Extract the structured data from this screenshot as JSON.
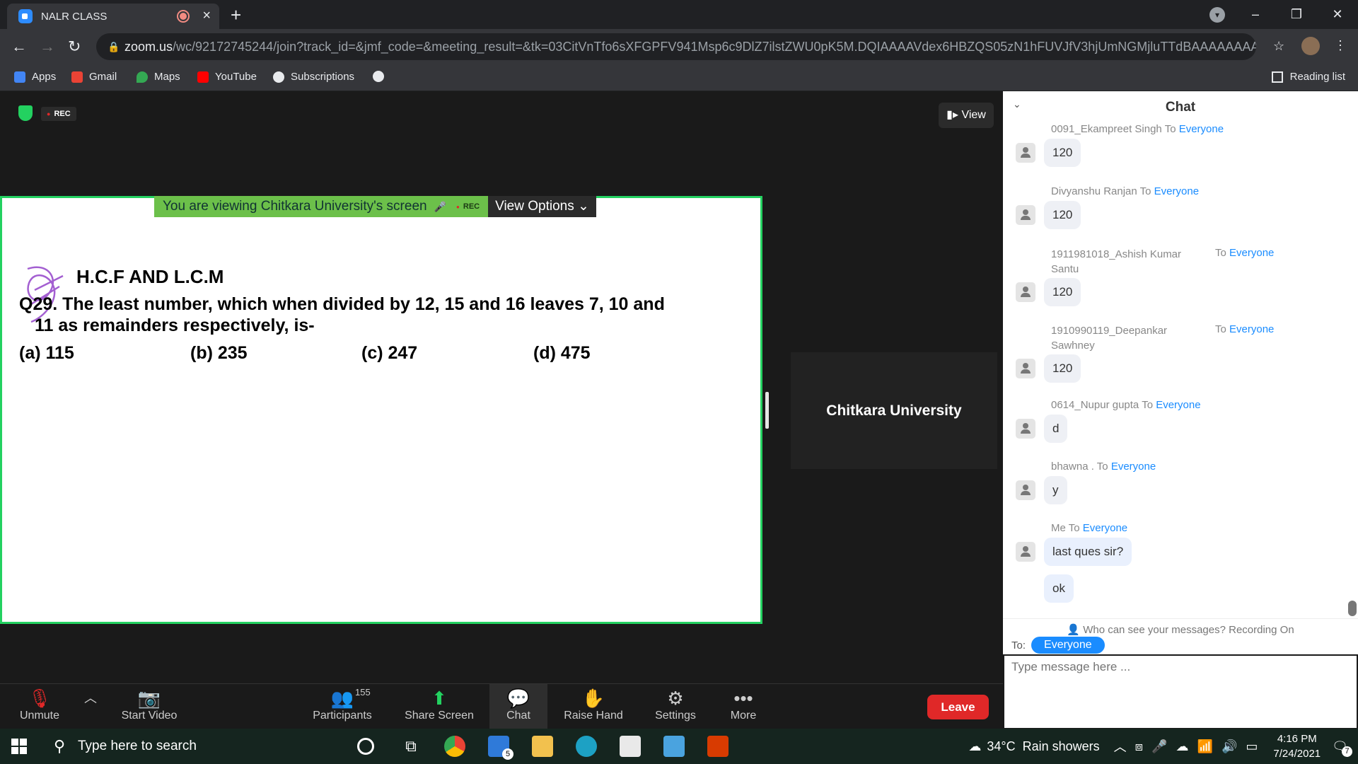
{
  "browser": {
    "tab_title": "NALR CLASS",
    "url_host": "zoom.us",
    "url_path": "/wc/92172745244/join?track_id=&jmf_code=&meeting_result=&tk=03CitVnTfo6sXFGPFV941Msp6c9DlZ7ilstZWU0pK5M.DQIAAAAVdex6HBZQS05zN1hFUVJfV3hjUmNGMjluTTdBAAAAAAAAA...",
    "bookmarks": [
      {
        "label": "Apps",
        "color": "#4285f4"
      },
      {
        "label": "Gmail",
        "color": "#ea4335"
      },
      {
        "label": "Maps",
        "color": "#34a853"
      },
      {
        "label": "YouTube",
        "color": "#ff0000"
      },
      {
        "label": "Subscriptions",
        "color": "#e8eaed"
      }
    ],
    "reading_list": "Reading list"
  },
  "meeting": {
    "rec_label": "REC",
    "view_label": "View",
    "viewing_text": "You are viewing Chitkara University's screen",
    "viewing_rec": "REC",
    "view_options": "View Options",
    "speaker_name": "Chitkara University"
  },
  "slide": {
    "title": "H.C.F AND L.C.M",
    "question_line1": "Q29. The least number, which when divided by 12, 15 and 16 leaves 7, 10 and",
    "question_line2": "11 as remainders respectively, is-",
    "options": [
      "(a) 115",
      "(b) 235",
      "(c) 247",
      "(d) 475"
    ]
  },
  "chat": {
    "title": "Chat",
    "to_word": "To",
    "everyone": "Everyone",
    "messages": [
      {
        "sender": "0091_Ekampreet Singh",
        "text": "120"
      },
      {
        "sender": "Divyanshu Ranjan",
        "text": "120"
      },
      {
        "sender": "1911981018_Ashish Kumar Santu",
        "text": "120"
      },
      {
        "sender": "1910990119_Deepankar Sawhney",
        "text": "120"
      },
      {
        "sender": "0614_Nupur gupta",
        "text": "d"
      },
      {
        "sender": "bhawna .",
        "text": "y"
      },
      {
        "sender": "Me",
        "text": "last ques sir?",
        "text2": "ok"
      }
    ],
    "who_can_see": "Who can see your messages? Recording On",
    "to_label": "To:",
    "to_target": "Everyone",
    "input_placeholder": "Type message here ..."
  },
  "toolbar": {
    "unmute": "Unmute",
    "start_video": "Start Video",
    "participants": "Participants",
    "participant_count": "155",
    "share_screen": "Share Screen",
    "chat": "Chat",
    "raise_hand": "Raise Hand",
    "settings": "Settings",
    "more": "More",
    "leave": "Leave"
  },
  "taskbar": {
    "search_placeholder": "Type here to search",
    "mail_badge": "5",
    "weather": "34°C  Rain showers",
    "time": "4:16 PM",
    "date": "7/24/2021",
    "notif_count": "7"
  }
}
